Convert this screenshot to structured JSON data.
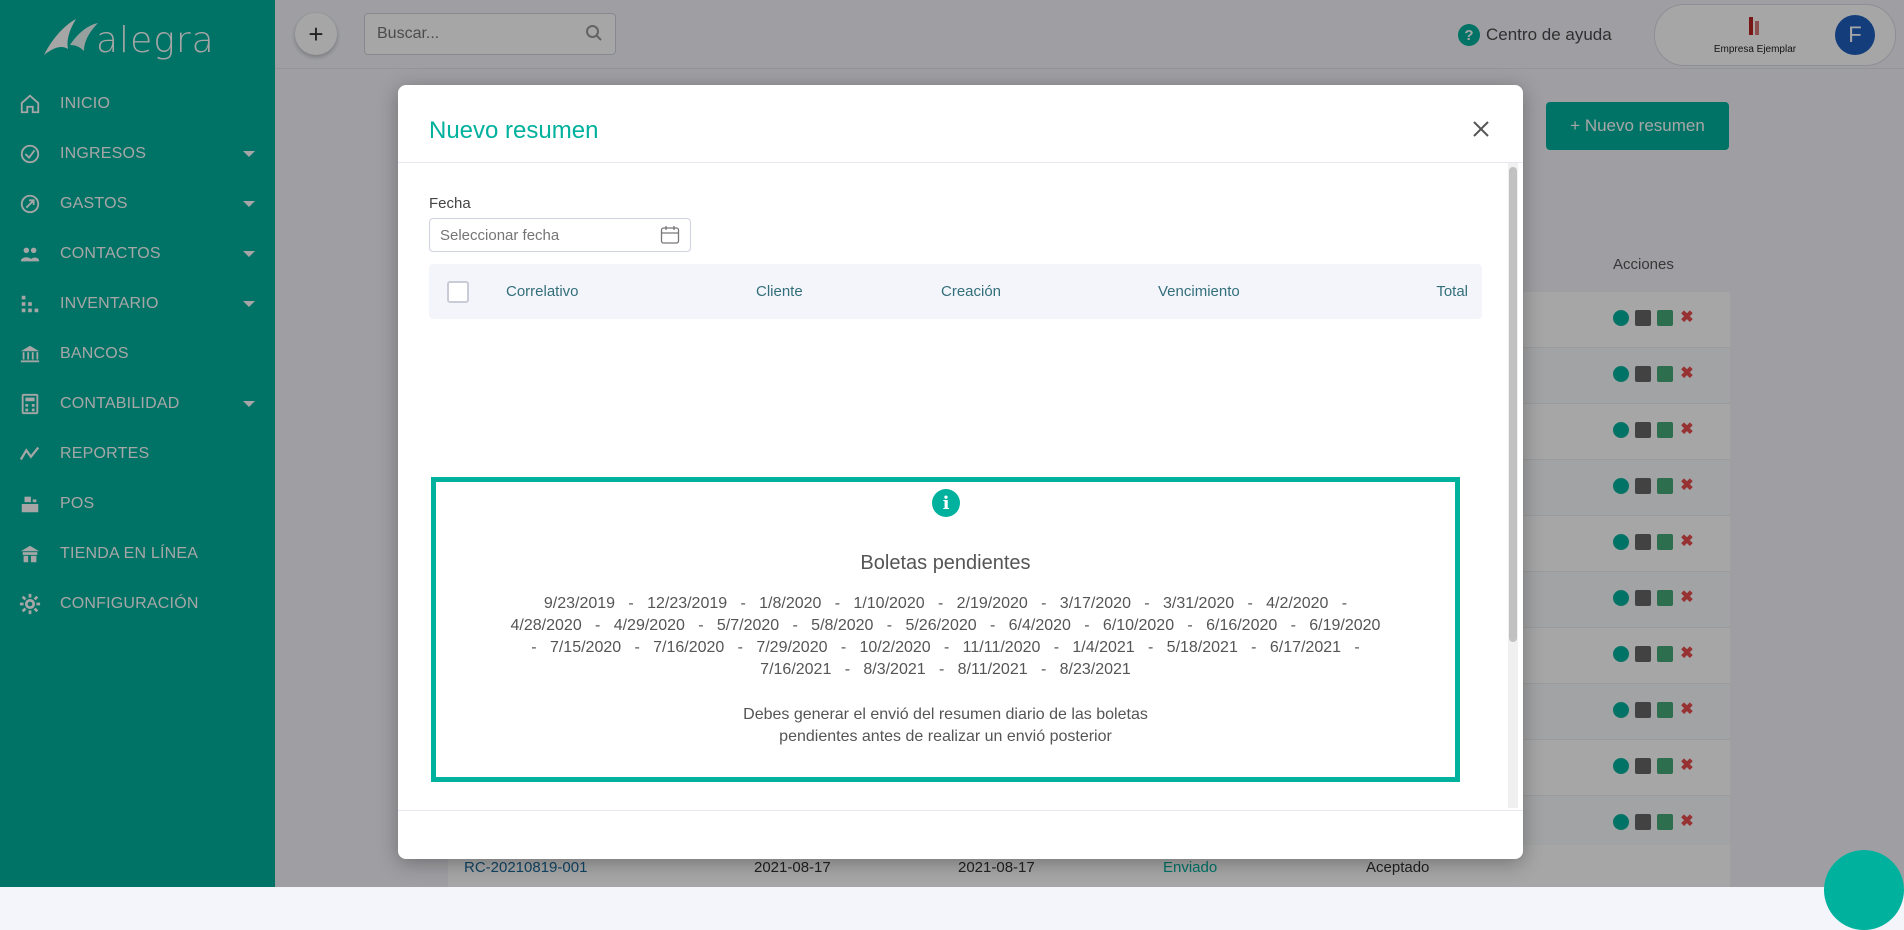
{
  "sidebar": {
    "logo_text": "alegra",
    "items": [
      {
        "label": "INICIO",
        "icon": "home-icon",
        "has_submenu": false
      },
      {
        "label": "INGRESOS",
        "icon": "income-icon",
        "has_submenu": true
      },
      {
        "label": "GASTOS",
        "icon": "expenses-icon",
        "has_submenu": true
      },
      {
        "label": "CONTACTOS",
        "icon": "contacts-icon",
        "has_submenu": true
      },
      {
        "label": "INVENTARIO",
        "icon": "inventory-icon",
        "has_submenu": true
      },
      {
        "label": "BANCOS",
        "icon": "bank-icon",
        "has_submenu": false
      },
      {
        "label": "CONTABILIDAD",
        "icon": "accounting-icon",
        "has_submenu": true
      },
      {
        "label": "REPORTES",
        "icon": "reports-icon",
        "has_submenu": false
      },
      {
        "label": "POS",
        "icon": "pos-icon",
        "has_submenu": false
      },
      {
        "label": "TIENDA EN LÍNEA",
        "icon": "store-icon",
        "has_submenu": false
      },
      {
        "label": "CONFIGURACIÓN",
        "icon": "gear-icon",
        "has_submenu": false
      }
    ]
  },
  "topbar": {
    "search_placeholder": "Buscar...",
    "help_label": "Centro de ayuda",
    "company_name": "Empresa Ejemplar",
    "avatar_initial": "F"
  },
  "background": {
    "new_summary_button": "+ Nuevo resumen",
    "actions_header": "Acciones",
    "visible_row": {
      "id": "RC-20210819-001",
      "date1": "2021-08-17",
      "date2": "2021-08-17",
      "status": "Enviado",
      "sunat": "Aceptado"
    }
  },
  "modal": {
    "title": "Nuevo resumen",
    "date_label": "Fecha",
    "date_placeholder": "Seleccionar fecha",
    "columns": [
      "Correlativo",
      "Cliente",
      "Creación",
      "Vencimiento",
      "Total"
    ],
    "notice": {
      "title": "Boletas pendientes",
      "date_lines": [
        "9/23/2019   -   12/23/2019   -   1/8/2020   -   1/10/2020   -   2/19/2020   -   3/17/2020   -   3/31/2020   -   4/2/2020   -",
        "4/28/2020   -   4/29/2020   -   5/7/2020   -   5/8/2020   -   5/26/2020   -   6/4/2020   -   6/10/2020   -   6/16/2020   -   6/19/2020",
        "-   7/15/2020   -   7/16/2020   -   7/29/2020   -   10/2/2020   -   11/11/2020   -   1/4/2021   -   5/18/2021   -   6/17/2021   -",
        "7/16/2021   -   8/3/2021   -   8/11/2021   -   8/23/2021"
      ],
      "message_line1": "Debes generar el envió del resumen diario de las boletas",
      "message_line2": "pendientes antes de realizar un envió posterior"
    }
  },
  "colors": {
    "brand": "#00b19d",
    "dark_button": "#0e3d44"
  }
}
